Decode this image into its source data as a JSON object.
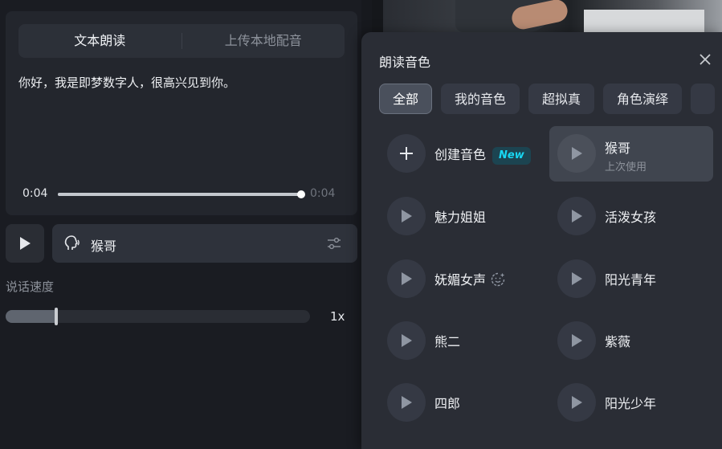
{
  "left": {
    "tabs": [
      "文本朗读",
      "上传本地配音"
    ],
    "text": "你好，我是即梦数字人，很高兴见到你。",
    "player": {
      "current_time": "0:04",
      "total_time": "0:04",
      "progress": 1.0
    },
    "selected_voice": "猴哥",
    "speed": {
      "label": "说话速度",
      "value": "1x",
      "level": 0.165
    }
  },
  "popup": {
    "title": "朗读音色",
    "filters": [
      {
        "label": "全部",
        "selected": true
      },
      {
        "label": "我的音色",
        "selected": false
      },
      {
        "label": "超拟真",
        "selected": false
      },
      {
        "label": "角色演绎",
        "selected": false
      }
    ],
    "create": {
      "label": "创建音色",
      "badge": "New"
    },
    "voices": [
      {
        "name": "猴哥",
        "sub": "上次使用",
        "selected": true
      },
      {
        "name": "魅力姐姐"
      },
      {
        "name": "活泼女孩"
      },
      {
        "name": "妩媚女声",
        "icon": "smile-icon"
      },
      {
        "name": "阳光青年"
      },
      {
        "name": "熊二"
      },
      {
        "name": "紫薇"
      },
      {
        "name": "四郎"
      },
      {
        "name": "阳光少年"
      }
    ]
  },
  "colors": {
    "accent_new": "#18d6f2",
    "panel": "#2a2d35"
  }
}
